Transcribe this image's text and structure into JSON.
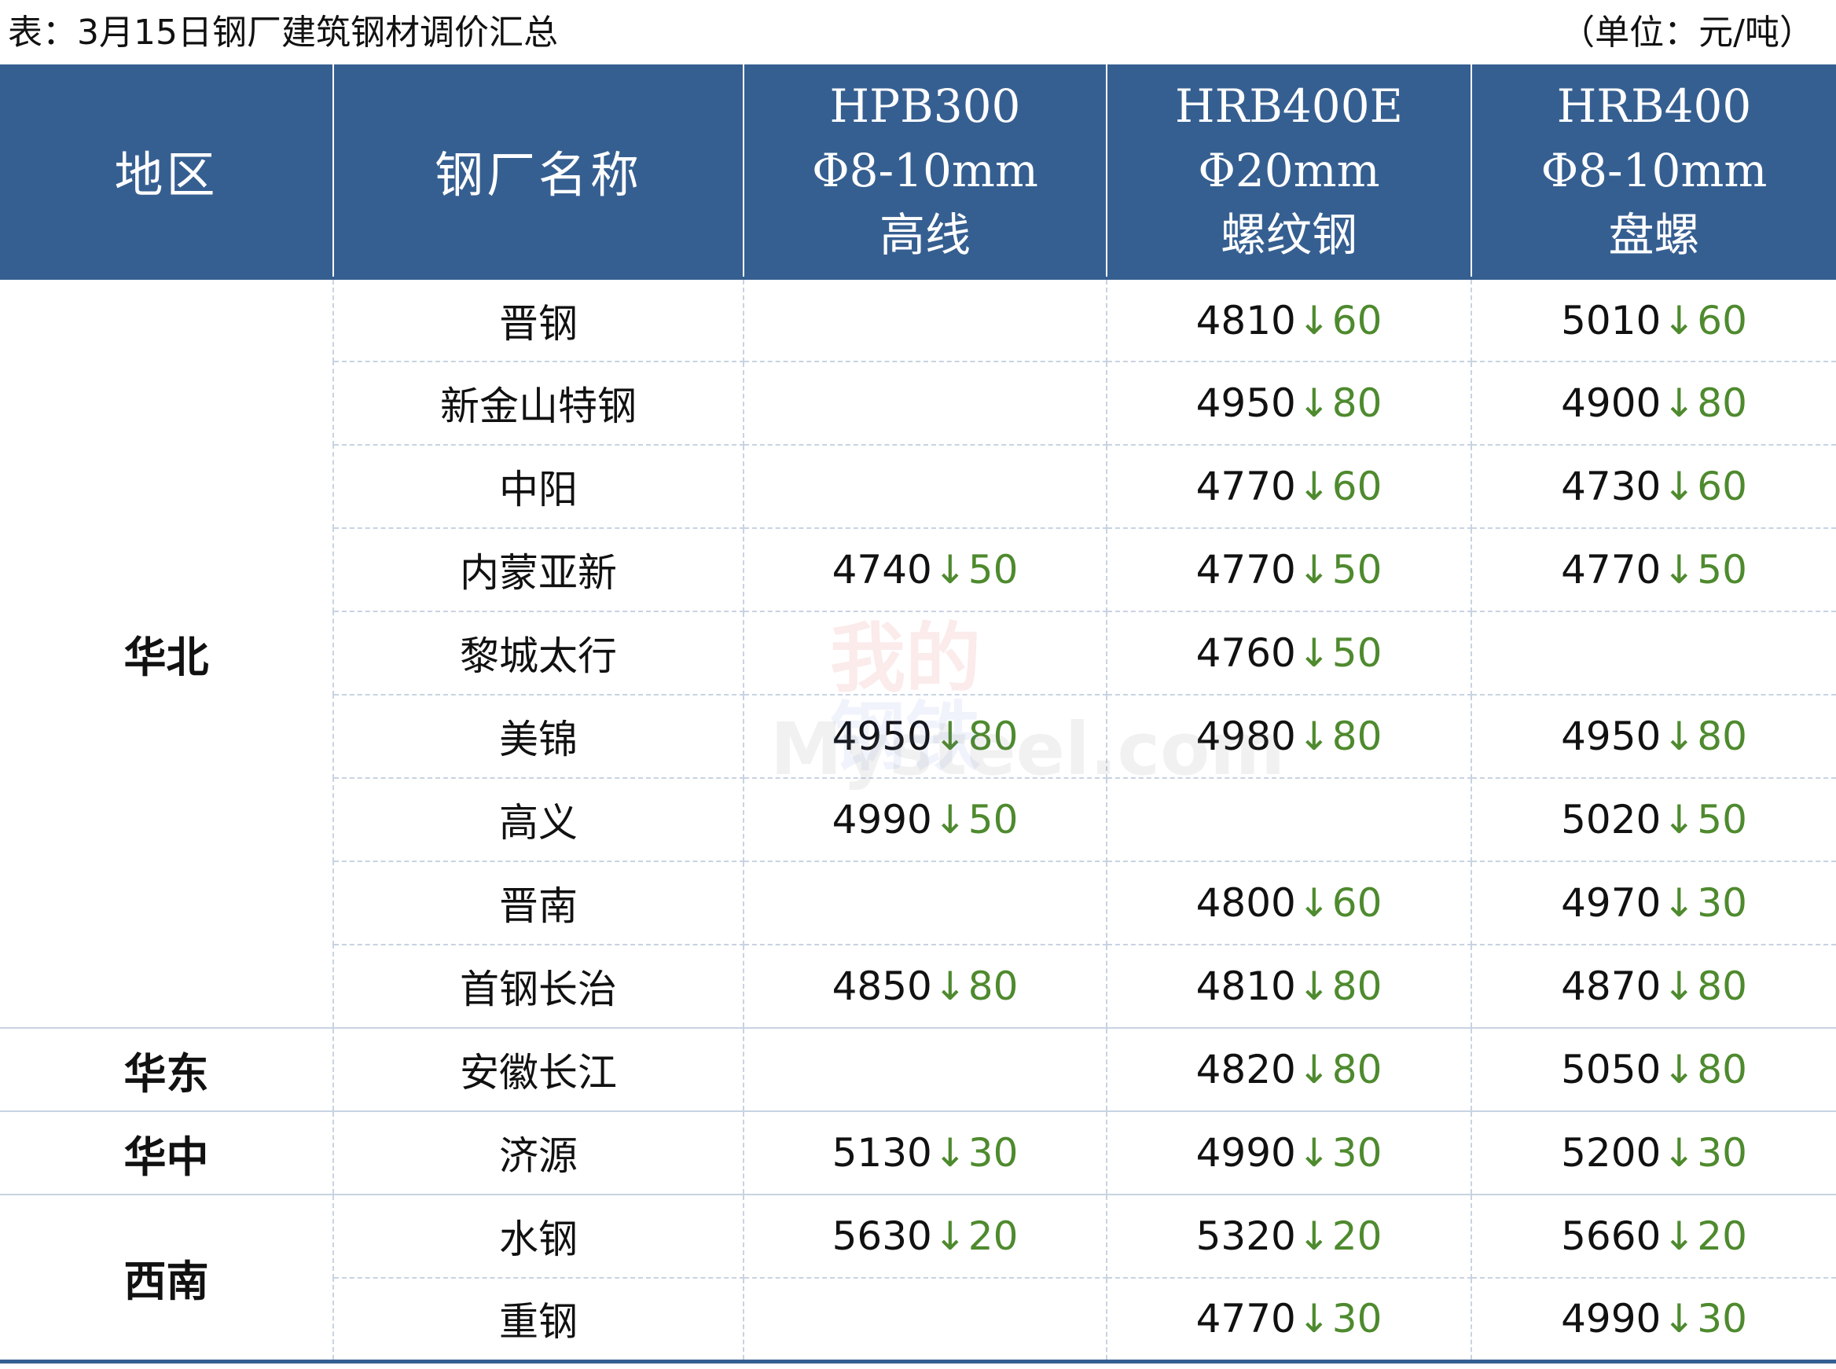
{
  "caption": {
    "title": "表：3月15日钢厂建筑钢材调价汇总",
    "unit": "（单位：元/吨）"
  },
  "headers": {
    "region": "地区",
    "mill": "钢厂名称",
    "hpb300": [
      "HPB300",
      "Φ8-10mm",
      "高线"
    ],
    "hrb400e": [
      "HRB400E",
      "Φ20mm",
      "螺纹钢"
    ],
    "hrb400": [
      "HRB400",
      "Φ8-10mm",
      "盘螺"
    ]
  },
  "watermark": {
    "line1": "我的",
    "line2": "钢铁",
    "brand": "Mysteel.com"
  },
  "arrow_symbol": "↓",
  "groups": [
    {
      "region": "华北",
      "rows": [
        {
          "mill": "晋钢",
          "hpb300": null,
          "hrb400e": {
            "price": "4810",
            "change": "60"
          },
          "hrb400": {
            "price": "5010",
            "change": "60"
          }
        },
        {
          "mill": "新金山特钢",
          "hpb300": null,
          "hrb400e": {
            "price": "4950",
            "change": "80"
          },
          "hrb400": {
            "price": "4900",
            "change": "80"
          }
        },
        {
          "mill": "中阳",
          "hpb300": null,
          "hrb400e": {
            "price": "4770",
            "change": "60"
          },
          "hrb400": {
            "price": "4730",
            "change": "60"
          }
        },
        {
          "mill": "内蒙亚新",
          "hpb300": {
            "price": "4740",
            "change": "50"
          },
          "hrb400e": {
            "price": "4770",
            "change": "50"
          },
          "hrb400": {
            "price": "4770",
            "change": "50"
          }
        },
        {
          "mill": "黎城太行",
          "hpb300": null,
          "hrb400e": {
            "price": "4760",
            "change": "50"
          },
          "hrb400": null
        },
        {
          "mill": "美锦",
          "hpb300": {
            "price": "4950",
            "change": "80"
          },
          "hrb400e": {
            "price": "4980",
            "change": "80"
          },
          "hrb400": {
            "price": "4950",
            "change": "80"
          }
        },
        {
          "mill": "高义",
          "hpb300": {
            "price": "4990",
            "change": "50"
          },
          "hrb400e": null,
          "hrb400": {
            "price": "5020",
            "change": "50"
          }
        },
        {
          "mill": "晋南",
          "hpb300": null,
          "hrb400e": {
            "price": "4800",
            "change": "60"
          },
          "hrb400": {
            "price": "4970",
            "change": "30"
          }
        },
        {
          "mill": "首钢长治",
          "hpb300": {
            "price": "4850",
            "change": "80"
          },
          "hrb400e": {
            "price": "4810",
            "change": "80"
          },
          "hrb400": {
            "price": "4870",
            "change": "80"
          }
        }
      ]
    },
    {
      "region": "华东",
      "rows": [
        {
          "mill": "安徽长江",
          "hpb300": null,
          "hrb400e": {
            "price": "4820",
            "change": "80"
          },
          "hrb400": {
            "price": "5050",
            "change": "80"
          }
        }
      ]
    },
    {
      "region": "华中",
      "rows": [
        {
          "mill": "济源",
          "hpb300": {
            "price": "5130",
            "change": "30"
          },
          "hrb400e": {
            "price": "4990",
            "change": "30"
          },
          "hrb400": {
            "price": "5200",
            "change": "30"
          }
        }
      ]
    },
    {
      "region": "西南",
      "rows": [
        {
          "mill": "水钢",
          "hpb300": {
            "price": "5630",
            "change": "20"
          },
          "hrb400e": {
            "price": "5320",
            "change": "20"
          },
          "hrb400": {
            "price": "5660",
            "change": "20"
          }
        },
        {
          "mill": "重钢",
          "hpb300": null,
          "hrb400e": {
            "price": "4770",
            "change": "30"
          },
          "hrb400": {
            "price": "4990",
            "change": "30"
          }
        }
      ]
    }
  ]
}
